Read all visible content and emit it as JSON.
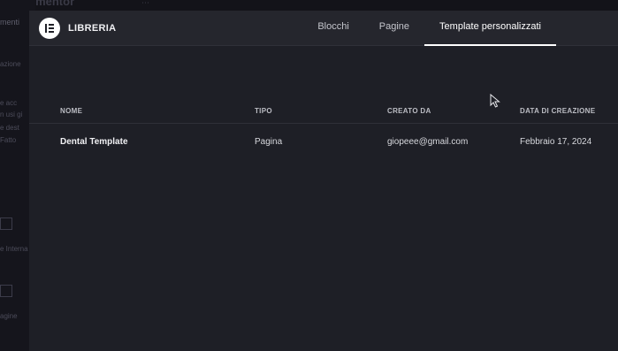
{
  "background": {
    "brand": "elementor",
    "tab": "menti",
    "snippets": [
      "azione",
      "e acc",
      "n usi gi",
      "e dest",
      "Fatto",
      "e Interna",
      "agine"
    ]
  },
  "library": {
    "title": "LIBRERIA",
    "tabs": [
      {
        "label": "Blocchi",
        "active": false
      },
      {
        "label": "Pagine",
        "active": false
      },
      {
        "label": "Template personalizzati",
        "active": true
      }
    ]
  },
  "table": {
    "headers": {
      "name": "NOME",
      "type": "TIPO",
      "created_by": "CREATO DA",
      "created_on": "DATA DI CREAZIONE"
    },
    "rows": [
      {
        "name": "Dental Template",
        "type": "Pagina",
        "created_by": "giopeee@gmail.com",
        "created_on": "Febbraio 17, 2024"
      }
    ]
  }
}
